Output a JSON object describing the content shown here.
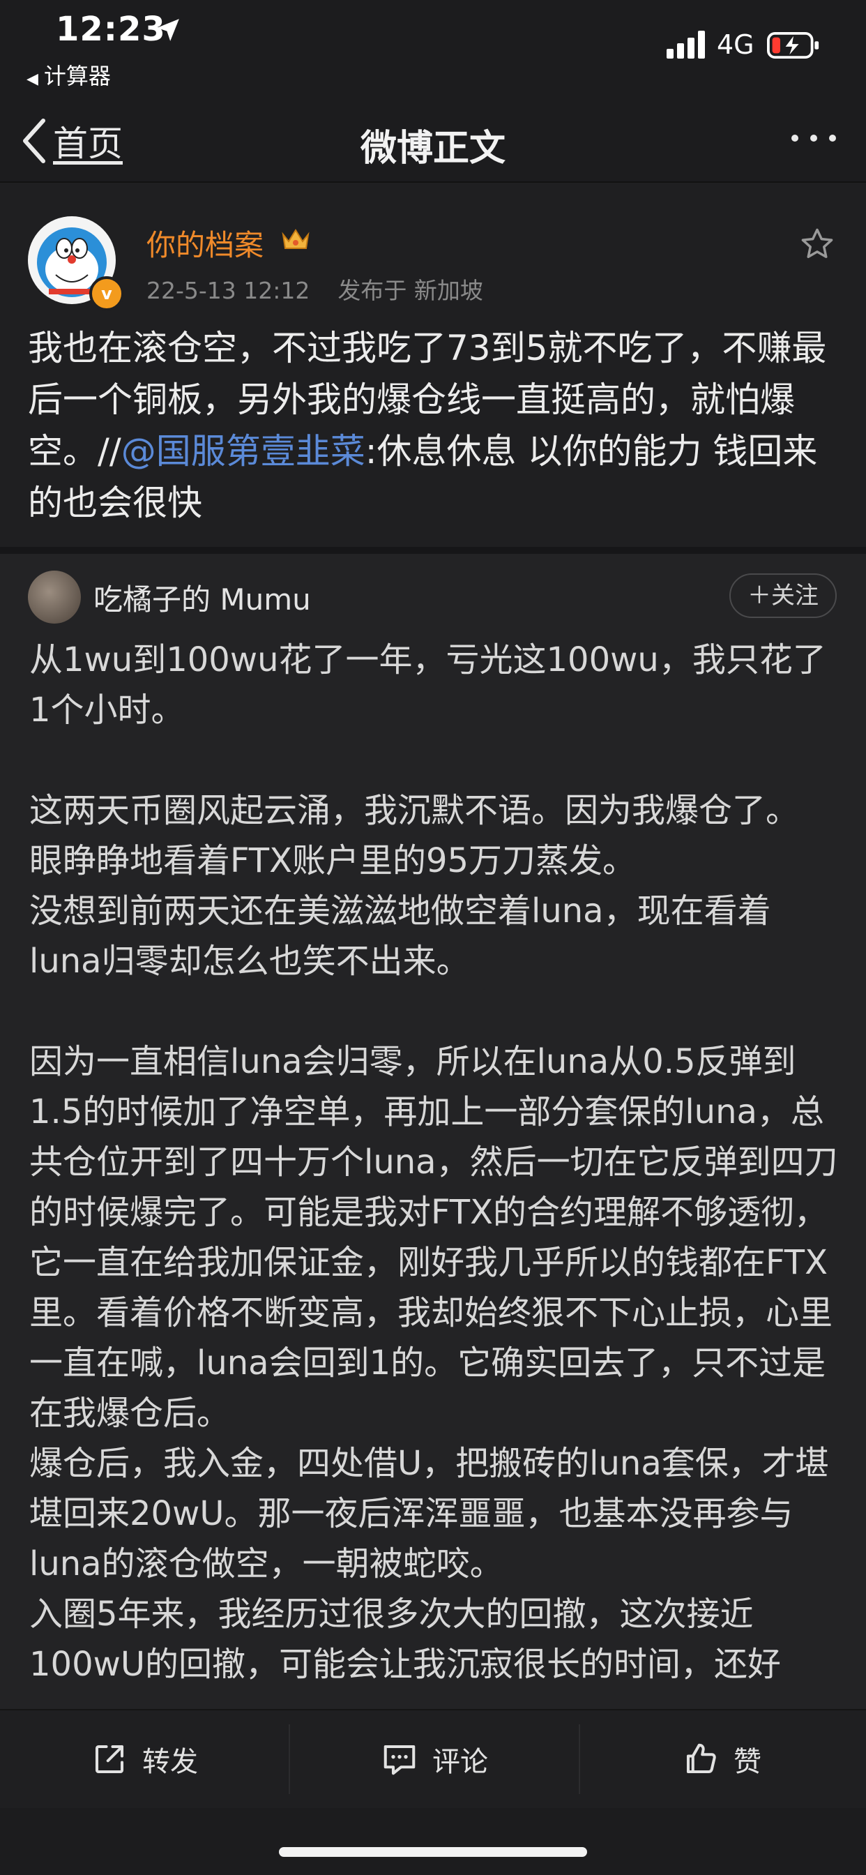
{
  "status_bar": {
    "time": "12:23",
    "back_app": "计算器",
    "network": "4G"
  },
  "nav": {
    "back_label": "首页",
    "title": "微博正文"
  },
  "post": {
    "author": "你的档案",
    "date": "22-5-13 12:12",
    "location": "发布于 新加坡",
    "text_before": "我也在滚仓空，不过我吃了73到5就不吃了，不赚最后一个铜板，另外我的爆仓线一直挺高的，就怕爆空。//",
    "mention": "@国服第壹韭菜",
    "text_after": ":休息休息 以你的能力 钱回来的也会很快"
  },
  "original": {
    "author": "吃橘子的 Mumu",
    "follow_label": "＋关注",
    "p1": "从1wu到100wu花了一年，亏光这100wu，我只花了1个小时。",
    "p2": "这两天币圈风起云涌，我沉默不语。因为我爆仓了。",
    "p3": "眼睁睁地看着FTX账户里的95万刀蒸发。",
    "p4": "没想到前两天还在美滋滋地做空着luna，现在看着luna归零却怎么也笑不出来。",
    "p5": "因为一直相信luna会归零，所以在luna从0.5反弹到1.5的时候加了净空单，再加上一部分套保的luna，总共仓位开到了四十万个luna，然后一切在它反弹到四刀的时候爆完了。可能是我对FTX的合约理解不够透彻，它一直在给我加保证金，刚好我几乎所以的钱都在FTX里。看着价格不断变高，我却始终狠不下心止损，心里一直在喊，luna会回到1的。它确实回去了，只不过是在我爆仓后。",
    "p6": "爆仓后，我入金，四处借U，把搬砖的luna套保，才堪堪回来20wU。那一夜后浑浑噩噩，也基本没再参与luna的滚仓做空，一朝被蛇咬。",
    "p7": "入圈5年来，我经历过很多次大的回撤，这次接近100wU的回撤，可能会让我沉寂很长的时间，还好"
  },
  "actions": {
    "repost": "转发",
    "comment": "评论",
    "like": "赞"
  },
  "colors": {
    "accent_orange": "#f08a2a",
    "mention_blue": "#5b8ad8",
    "background": "#1c1c1e"
  }
}
